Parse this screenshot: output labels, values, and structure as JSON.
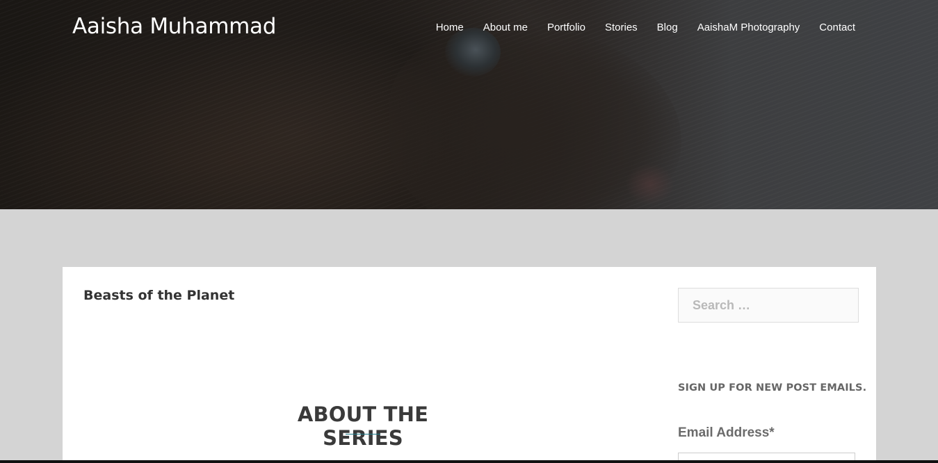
{
  "header": {
    "site_title": "Aaisha Muhammad",
    "nav": [
      {
        "label": "Home"
      },
      {
        "label": "About me"
      },
      {
        "label": "Portfolio"
      },
      {
        "label": "Stories"
      },
      {
        "label": "Blog"
      },
      {
        "label": "AaishaM Photography"
      },
      {
        "label": "Contact"
      }
    ]
  },
  "main": {
    "post_title": "Beasts of the Planet",
    "section_heading": "ABOUT THE SERIES"
  },
  "sidebar": {
    "search_placeholder": "Search …",
    "signup_title": "SIGN UP FOR NEW POST EMAILS.",
    "email_label": "Email Address*"
  },
  "colors": {
    "accent": "#1e7b8a",
    "page_background": "#d4d4d4",
    "card_background": "#ffffff"
  }
}
